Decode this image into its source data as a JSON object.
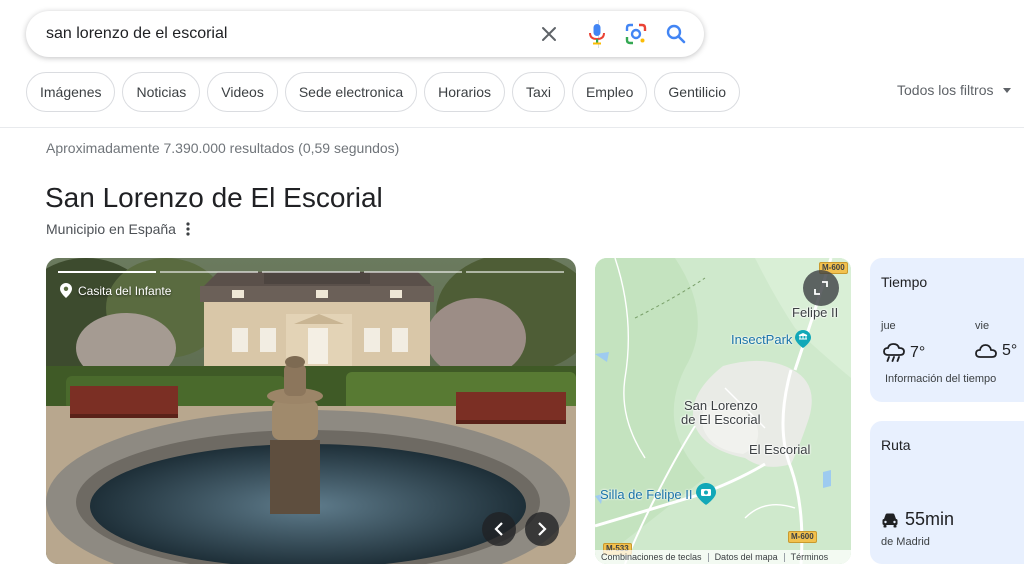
{
  "search": {
    "query": "san lorenzo de el escorial",
    "clear_icon": "close-icon",
    "voice_icon": "microphone-icon",
    "lens_icon": "google-lens-icon",
    "search_icon": "search-icon"
  },
  "chips": [
    "Imágenes",
    "Noticias",
    "Videos",
    "Sede electronica",
    "Horarios",
    "Taxi",
    "Empleo",
    "Gentilicio"
  ],
  "filters": {
    "label": "Todos los filtros"
  },
  "results": {
    "stats": "Aproximadamente 7.390.000 resultados (0,59 segundos)"
  },
  "knowledge_panel": {
    "title": "San Lorenzo de El Escorial",
    "subtitle": "Municipio en España",
    "photo": {
      "label": "Casita del Infante",
      "progress": {
        "total": 5,
        "active": 1
      }
    },
    "map": {
      "labels": {
        "felipe": "Felipe II",
        "insect": "InsectPark",
        "town_line1": "San Lorenzo",
        "town_line2": "de El Escorial",
        "escorial": "El Escorial",
        "silla": "Silla de Felipe II"
      },
      "roads": {
        "m600_top": "M-600",
        "m600_bottom": "M-600",
        "m533": "M-533"
      },
      "footer": {
        "shortcuts": "Combinaciones de teclas",
        "data": "Datos del mapa",
        "terms": "Términos"
      }
    },
    "weather": {
      "title": "Tiempo",
      "days": [
        {
          "day": "jue",
          "temp": "7°",
          "icon": "rain-cloud-icon"
        },
        {
          "day": "vie",
          "temp": "5°",
          "icon": "cloud-icon"
        }
      ],
      "info": "Información del tiempo"
    },
    "route": {
      "title": "Ruta",
      "time": "55min",
      "from": "de Madrid",
      "icon": "car-icon"
    }
  },
  "colors": {
    "brand_blue": "#4285f4",
    "mic_red": "#ea4335",
    "card_bg": "#e8f0fe",
    "map_green": "#cfe9cc"
  }
}
